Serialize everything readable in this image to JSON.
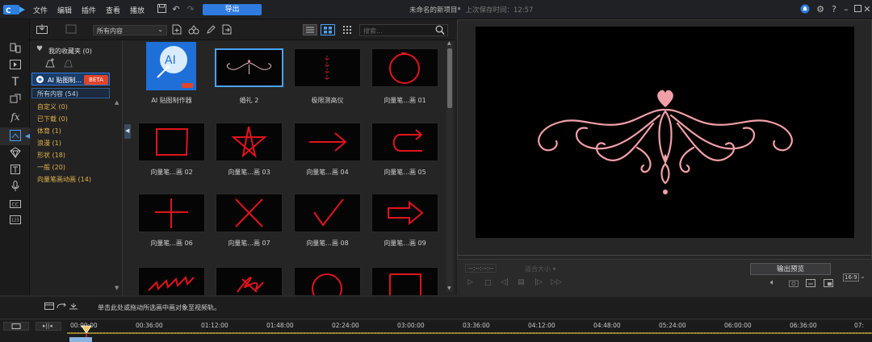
{
  "menu": {
    "items": [
      "文件",
      "编辑",
      "插件",
      "查看",
      "播放"
    ],
    "export_label": "导出",
    "project_title": "未命名的新项目*",
    "last_saved": "上次保存时间：12:57"
  },
  "library": {
    "filter_select": "所有内容",
    "search_placeholder": "搜索...",
    "favorites": "我的收藏夹 (0)",
    "ai_item": "AI 贴图制...",
    "beta_badge": "BETA",
    "all_content": "所有内容 (54)",
    "categories": [
      "自定义 (0)",
      "已下载 (0)",
      "体育 (1)",
      "浪漫 (1)",
      "形状 (18)",
      "一般 (20)",
      "向量笔画动画 (14)"
    ],
    "thumbs": [
      {
        "label": "AI 贴图制作器",
        "icon": "ai-sticker-maker-icon",
        "ai_text": "AI"
      },
      {
        "label": "婚礼 2",
        "icon": "wedding-ornament-icon"
      },
      {
        "label": "极限测高仪",
        "icon": "altimeter-icon"
      },
      {
        "label": "向量笔...画 01",
        "icon": "red-circle-stroke-icon"
      },
      {
        "label": "向量笔...画 02",
        "icon": "red-square-stroke-icon"
      },
      {
        "label": "向量笔...画 03",
        "icon": "red-star-stroke-icon"
      },
      {
        "label": "向量笔...画 04",
        "icon": "red-arrow-right-icon"
      },
      {
        "label": "向量笔...画 05",
        "icon": "red-uturn-arrow-icon"
      },
      {
        "label": "向量笔...画 06",
        "icon": "red-plus-icon"
      },
      {
        "label": "向量笔...画 07",
        "icon": "red-cross-icon"
      },
      {
        "label": "向量笔...画 08",
        "icon": "red-check-icon"
      },
      {
        "label": "向量笔...画 09",
        "icon": "red-block-arrow-icon"
      },
      {
        "label": "",
        "icon": "red-zigzag-icon"
      },
      {
        "label": "",
        "icon": "red-scribble-icon"
      },
      {
        "label": "",
        "icon": "red-circle-icon"
      },
      {
        "label": "",
        "icon": "red-square-icon"
      }
    ]
  },
  "preview": {
    "timecode": "--:--:--:--",
    "zoom_label": "适合大小",
    "output_preview_btn": "输出预览",
    "aspect_ratio": "16:9"
  },
  "timeline": {
    "hint": "单击此处或拖动所选画中画对象至视频轨。",
    "ruler": [
      "00:00:00",
      "00:36:00",
      "01:12:00",
      "01:48:00",
      "02:24:00",
      "03:00:00",
      "03:36:00",
      "04:12:00",
      "04:48:00",
      "05:24:00",
      "06:00:00",
      "06:36:00",
      "07:"
    ]
  },
  "colors": {
    "accent": "#2f7be0",
    "category_text": "#e0b24a",
    "stroke_red": "#e0141c",
    "ornament_pink": "#f2a0a8",
    "beta": "#e0442a"
  }
}
